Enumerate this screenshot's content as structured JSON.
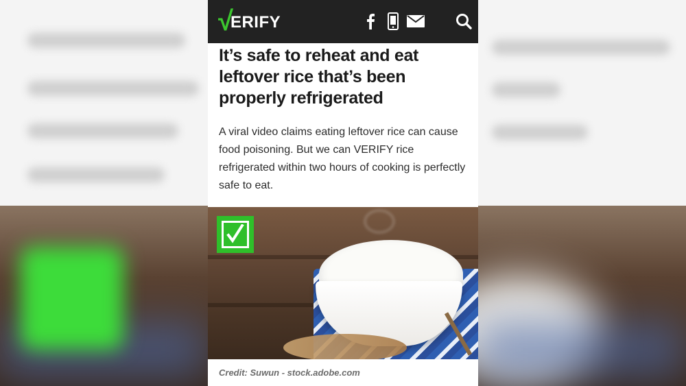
{
  "header": {
    "logo_check": "√",
    "logo_word": "ERIFY",
    "icons": [
      "facebook-icon",
      "mobile-icon",
      "email-icon",
      "search-icon"
    ]
  },
  "article": {
    "headline": "It’s safe to reheat and eat leftover rice that’s been properly refrigerated",
    "summary": "A viral video claims eating leftover rice can cause food poisoning. But we can VERIFY rice refrigerated within two hours of cooking is perfectly safe to eat.",
    "image": {
      "badge": "verified-check",
      "credit": "Credit: Suwun - stock.adobe.com"
    }
  },
  "colors": {
    "header_bg": "#222222",
    "brand_green": "#3cc72f",
    "badge_green": "#2fbf2a",
    "text": "#1a1a1a"
  }
}
